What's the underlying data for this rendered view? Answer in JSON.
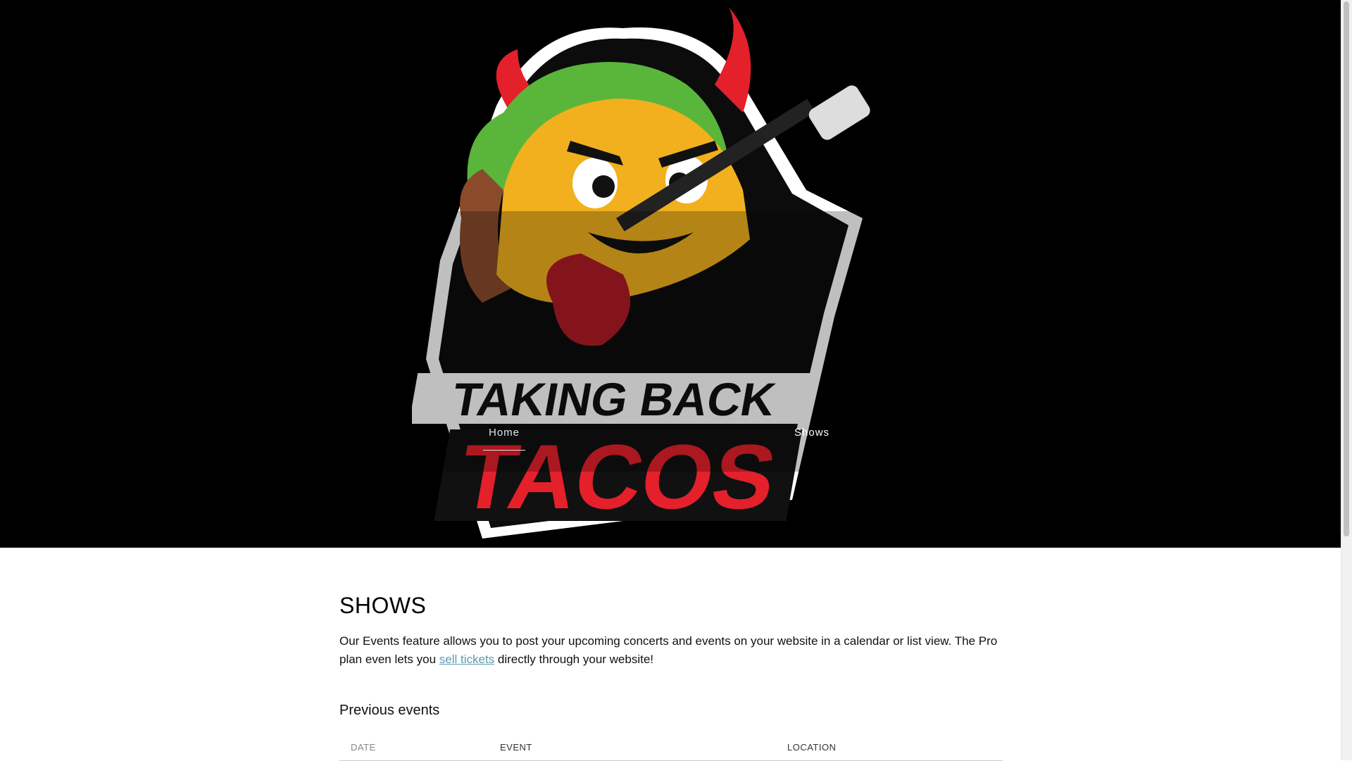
{
  "brand": {
    "logo_text_line1": "TAKING BACK",
    "logo_text_line2": "TACOS"
  },
  "nav": {
    "items": [
      {
        "label": "Home",
        "active": true
      },
      {
        "label": "Shows",
        "active": false
      }
    ]
  },
  "main": {
    "title": "SHOWS",
    "intro_before_link": "Our Events feature allows you to post your upcoming concerts and events on your website in a calendar or list view. The Pro plan even lets you ",
    "intro_link": "sell tickets",
    "intro_after_link": " directly through your website!",
    "section_title": "Previous events",
    "table": {
      "columns": [
        "DATE",
        "EVENT",
        "LOCATION"
      ]
    }
  },
  "colors": {
    "header_bg": "#000000",
    "link": "#5b9db1",
    "taco_yellow": "#f2b01e",
    "devil_red": "#e4202b",
    "lettuce_green": "#5ab63a"
  },
  "icons": {
    "logo": "devil-taco-guitar-logo"
  }
}
